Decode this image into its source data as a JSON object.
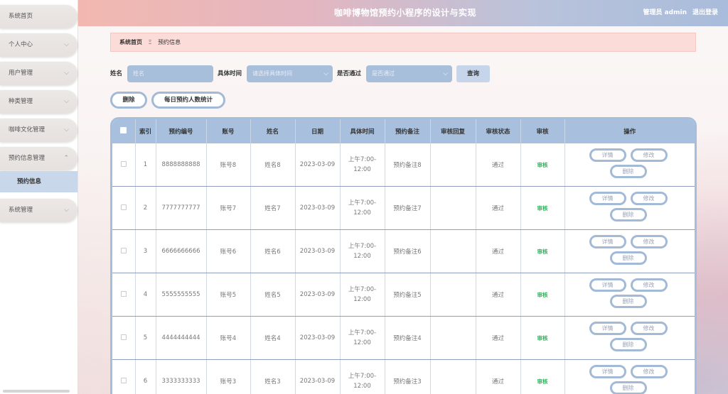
{
  "header": {
    "title": "咖啡博物馆预约小程序的设计与实现",
    "user": "管理员 admin",
    "logout": "退出登录"
  },
  "sidebar": {
    "items": [
      {
        "label": "系统首页",
        "has_chevron": false
      },
      {
        "label": "个人中心",
        "has_chevron": true
      },
      {
        "label": "用户管理",
        "has_chevron": true
      },
      {
        "label": "种类管理",
        "has_chevron": true
      },
      {
        "label": "咖啡文化管理",
        "has_chevron": true
      },
      {
        "label": "预约信息管理",
        "has_chevron": true,
        "expanded": true
      },
      {
        "label": "系统管理",
        "has_chevron": true
      }
    ],
    "submenu": {
      "label": "预约信息"
    }
  },
  "breadcrumb": {
    "home": "系统首页",
    "separator": "Ξ",
    "current": "预约信息"
  },
  "search": {
    "name_label": "姓名",
    "name_placeholder": "姓名",
    "time_label": "具体时间",
    "time_placeholder": "请选择具体时间",
    "passed_label": "是否通过",
    "passed_placeholder": "是否通过",
    "search_button": "查询"
  },
  "actions": {
    "delete": "删除",
    "daily_stats": "每日预约人数统计"
  },
  "table": {
    "headers": [
      "索引",
      "预约编号",
      "账号",
      "姓名",
      "日期",
      "具体时间",
      "预约备注",
      "审核回复",
      "审核状态",
      "审核",
      "操作"
    ],
    "rows": [
      {
        "index": "1",
        "code": "8888888888",
        "account": "账号8",
        "name": "姓名8",
        "date": "2023-03-09",
        "time": "上午7:00-12:00",
        "note": "预约备注8",
        "reply": "",
        "status": "通过",
        "audit": "审核"
      },
      {
        "index": "2",
        "code": "7777777777",
        "account": "账号7",
        "name": "姓名7",
        "date": "2023-03-09",
        "time": "上午7:00-12:00",
        "note": "预约备注7",
        "reply": "",
        "status": "通过",
        "audit": "审核"
      },
      {
        "index": "3",
        "code": "6666666666",
        "account": "账号6",
        "name": "姓名6",
        "date": "2023-03-09",
        "time": "上午7:00-12:00",
        "note": "预约备注6",
        "reply": "",
        "status": "通过",
        "audit": "审核"
      },
      {
        "index": "4",
        "code": "5555555555",
        "account": "账号5",
        "name": "姓名5",
        "date": "2023-03-09",
        "time": "上午7:00-12:00",
        "note": "预约备注5",
        "reply": "",
        "status": "通过",
        "audit": "审核"
      },
      {
        "index": "5",
        "code": "4444444444",
        "account": "账号4",
        "name": "姓名4",
        "date": "2023-03-09",
        "time": "上午7:00-12:00",
        "note": "预约备注4",
        "reply": "",
        "status": "通过",
        "audit": "审核"
      },
      {
        "index": "6",
        "code": "3333333333",
        "account": "账号3",
        "name": "姓名3",
        "date": "2023-03-09",
        "time": "上午7:00-12:00",
        "note": "预约备注3",
        "reply": "",
        "status": "通过",
        "audit": "审核"
      }
    ],
    "op_labels": {
      "detail": "详情",
      "edit": "修改",
      "delete": "删除"
    }
  },
  "colors": {
    "accent": "#a8c0dd",
    "audit_link": "#2eb15a",
    "breadcrumb_bg": "#fcdcd8"
  }
}
